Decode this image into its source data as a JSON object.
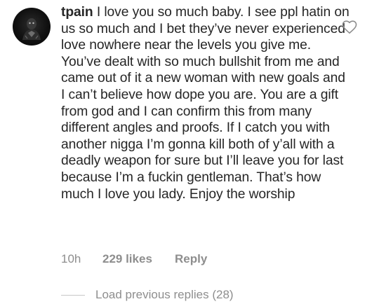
{
  "comment": {
    "avatar_icon": "profile-avatar",
    "username": "tpain",
    "text": "I love you so much baby. I see ppl hatin on us so much and I bet they’ve never experienced love nowhere near the levels you give me. You’ve dealt with so much bullshit from me and came out of it a new woman with new goals and I can’t believe how dope you are. You are a gift from god and I can confirm this from many different angles and proofs. If I catch you with another nigga I’m gonna kill both of y’all with a deadly weapon for sure but I’ll leave you for last because I’m a fuckin gentleman. That’s how much I love you lady. Enjoy the worship",
    "time": "10h",
    "likes": "229 likes",
    "reply_label": "Reply",
    "like_icon": "heart-outline-icon"
  },
  "replies": {
    "load_previous_label": "Load previous replies (28)"
  },
  "colors": {
    "text_primary": "#262626",
    "text_secondary": "#8e8e8e",
    "divider": "#c7c7c7",
    "background": "#ffffff"
  }
}
